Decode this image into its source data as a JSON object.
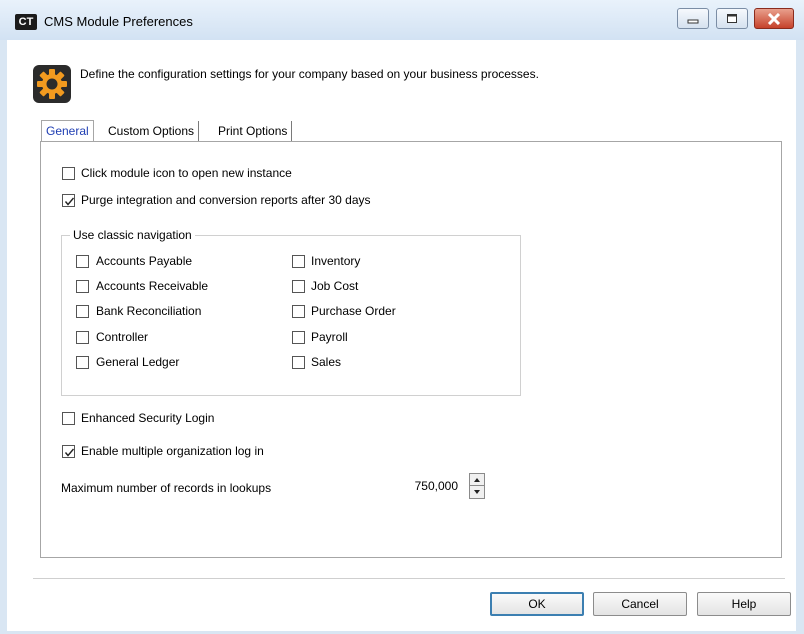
{
  "window": {
    "logo": "CT",
    "title": "CMS Module Preferences",
    "header_description": "Define the configuration settings for your company based on your business processes."
  },
  "tabs": [
    {
      "label": "General",
      "active": true
    },
    {
      "label": "Custom Options",
      "active": false
    },
    {
      "label": "Print Options",
      "active": false
    }
  ],
  "general": {
    "click_module_icon": {
      "label": "Click module icon to open new instance",
      "checked": false
    },
    "purge_reports": {
      "label": "Purge integration and conversion reports after 30 days",
      "checked": true
    },
    "classic_navigation": {
      "title": "Use classic navigation",
      "left": [
        {
          "label": "Accounts Payable",
          "checked": false
        },
        {
          "label": "Accounts Receivable",
          "checked": false
        },
        {
          "label": "Bank Reconciliation",
          "checked": false
        },
        {
          "label": "Controller",
          "checked": false
        },
        {
          "label": "General Ledger",
          "checked": false
        }
      ],
      "right": [
        {
          "label": "Inventory",
          "checked": false
        },
        {
          "label": "Job Cost",
          "checked": false
        },
        {
          "label": "Purchase Order",
          "checked": false
        },
        {
          "label": "Payroll",
          "checked": false
        },
        {
          "label": "Sales",
          "checked": false
        }
      ]
    },
    "enhanced_security": {
      "label": "Enhanced Security Login",
      "checked": false
    },
    "multiple_org": {
      "label": "Enable multiple organization log in",
      "checked": true
    },
    "max_records": {
      "label": "Maximum number of records in lookups",
      "value": "750,000"
    }
  },
  "buttons": {
    "ok": "OK",
    "cancel": "Cancel",
    "help": "Help"
  },
  "colors": {
    "active_tab_text": "#1f3eb3",
    "ok_border": "#3c7fb1",
    "close_button": "#c6422b"
  }
}
